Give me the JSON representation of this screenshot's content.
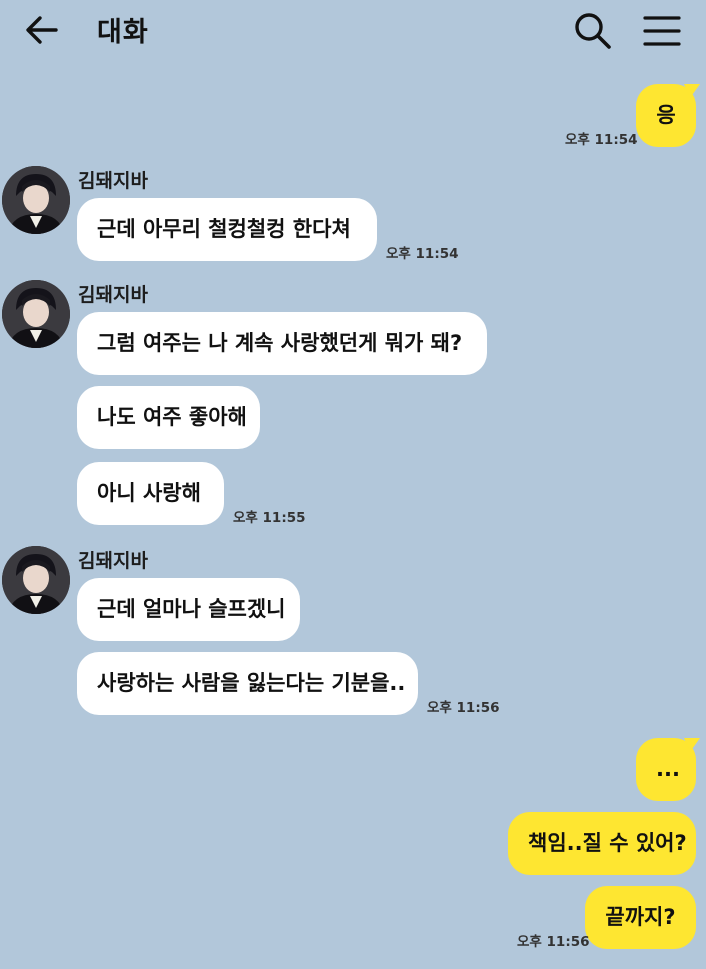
{
  "header": {
    "title": "대화",
    "back_icon": "arrow-left-icon",
    "search_icon": "search-icon",
    "menu_icon": "hamburger-menu-icon"
  },
  "colors": {
    "background": "#b2c7da",
    "incoming_bubble": "#ffffff",
    "outgoing_bubble": "#fee631"
  },
  "messages": {
    "m1": {
      "text": "응",
      "time": "오후 11:54"
    },
    "g1": {
      "sender": "김돼지바",
      "b1": "근데 아무리 철컹철컹 한다쳐",
      "time": "오후 11:54"
    },
    "g2": {
      "sender": "김돼지바",
      "b1": "그럼 여주는 나 계속 사랑했던게 뭐가 돼?",
      "b2": "나도 여주 좋아해",
      "b3": "아니 사랑해",
      "time": "오후 11:55"
    },
    "g3": {
      "sender": "김돼지바",
      "b1": "근데 얼마나 슬프겠니",
      "b2": "사랑하는 사람을 잃는다는 기분을..",
      "time": "오후 11:56"
    },
    "m2": {
      "b1": "...",
      "b2": "책임..질 수 있어?",
      "b3": "끝까지?",
      "time": "오후 11:56"
    }
  }
}
